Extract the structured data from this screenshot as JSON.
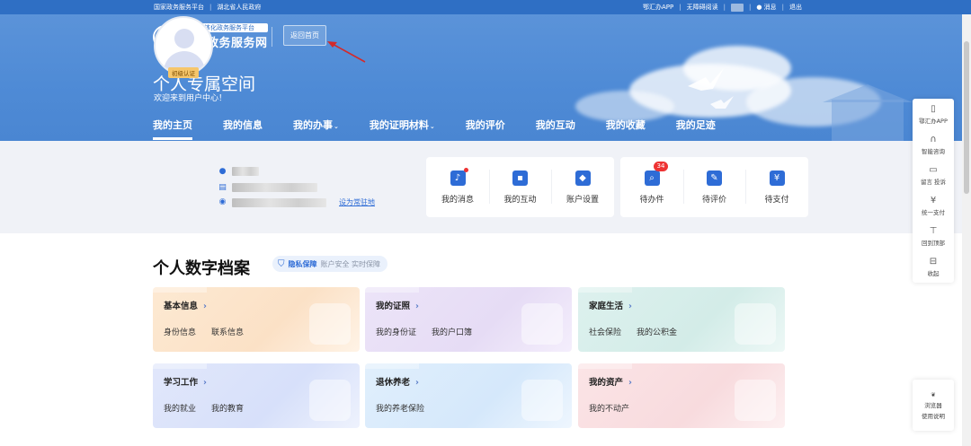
{
  "topbar": {
    "left_links": [
      "国家政务服务平台",
      "湖北省人民政府"
    ],
    "right_links": [
      "鄂汇办APP",
      "无障碍阅读"
    ],
    "message": "消息",
    "logout": "退出"
  },
  "header": {
    "logo_sub": "全国一体化政务服务平台",
    "logo_name": "湖北政务服务网",
    "back_home": "返回首页"
  },
  "hero": {
    "title": "个人专属空间",
    "subtitle": "欢迎来到用户中心！"
  },
  "nav": {
    "items": [
      {
        "label": "我的主页",
        "active": true,
        "dropdown": false
      },
      {
        "label": "我的信息",
        "active": false,
        "dropdown": false
      },
      {
        "label": "我的办事",
        "active": false,
        "dropdown": true
      },
      {
        "label": "我的证明材料",
        "active": false,
        "dropdown": true
      },
      {
        "label": "我的评价",
        "active": false,
        "dropdown": false
      },
      {
        "label": "我的互动",
        "active": false,
        "dropdown": false
      },
      {
        "label": "我的收藏",
        "active": false,
        "dropdown": false
      },
      {
        "label": "我的足迹",
        "active": false,
        "dropdown": false
      }
    ]
  },
  "profile": {
    "badge": "初级认证",
    "set_default_link": "设为常驻地"
  },
  "quick_actions": [
    {
      "label": "我的消息",
      "icon": "bell-icon"
    },
    {
      "label": "我的互动",
      "icon": "chat-icon"
    },
    {
      "label": "账户设置",
      "icon": "settings-icon"
    }
  ],
  "quick_tasks": [
    {
      "label": "待办件",
      "icon": "search-doc-icon",
      "count": "34"
    },
    {
      "label": "待评价",
      "icon": "edit-icon"
    },
    {
      "label": "待支付",
      "icon": "pay-icon"
    }
  ],
  "archive": {
    "title": "个人数字档案",
    "privacy_label": "隐私保障",
    "privacy_desc": "账户安全 实时保障"
  },
  "cards": [
    {
      "title": "基本信息",
      "items": [
        "身份信息",
        "联系信息"
      ]
    },
    {
      "title": "我的证照",
      "items": [
        "我的身份证",
        "我的户口簿"
      ]
    },
    {
      "title": "家庭生活",
      "items": [
        "社会保险",
        "我的公积金"
      ]
    },
    {
      "title": "学习工作",
      "items": [
        "我的就业",
        "我的教育"
      ]
    },
    {
      "title": "退休养老",
      "items": [
        "我的养老保险"
      ]
    },
    {
      "title": "我的资产",
      "items": [
        "我的不动产"
      ]
    }
  ],
  "float_panel": [
    {
      "label": "鄂汇办APP",
      "icon": "phone-icon"
    },
    {
      "label": "智能咨询",
      "icon": "headset-icon"
    },
    {
      "label": "留言 投诉",
      "icon": "message-icon"
    },
    {
      "label": "统一支付",
      "icon": "yen-icon"
    },
    {
      "label": "回到顶部",
      "icon": "top-icon"
    },
    {
      "label": "收起",
      "icon": "collapse-icon"
    }
  ],
  "browser_tip": {
    "line1": "浏览器",
    "line2": "使用说明"
  }
}
